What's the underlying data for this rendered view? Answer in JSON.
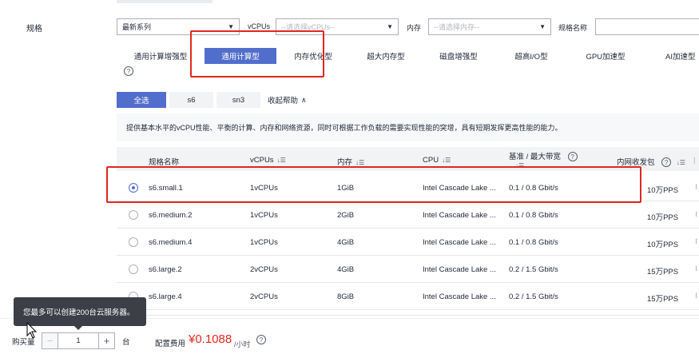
{
  "section_label": "规格",
  "filters": {
    "series": {
      "value": "最新系列"
    },
    "vcpu": {
      "label": "vCPUs",
      "placeholder": "--请选择vCPUs--"
    },
    "memory": {
      "label": "内存",
      "placeholder": "--请选择内存--"
    },
    "spec_name": {
      "label": "规格名称"
    }
  },
  "categories": [
    {
      "label": "通用计算增强型",
      "active": false
    },
    {
      "label": "通用计算型",
      "active": true
    },
    {
      "label": "内存优化型",
      "active": false
    },
    {
      "label": "超大内存型",
      "active": false
    },
    {
      "label": "磁盘增强型",
      "active": false
    },
    {
      "label": "超高I/O型",
      "active": false
    },
    {
      "label": "GPU加速型",
      "active": false
    },
    {
      "label": "AI加速型",
      "active": false
    }
  ],
  "subtabs": [
    {
      "label": "全选",
      "active": true
    },
    {
      "label": "s6",
      "active": false
    },
    {
      "label": "sn3",
      "active": false
    }
  ],
  "collapse_help": "收起帮助",
  "description": "提供基本水平的vCPU性能、平衡的计算、内存和网络资源，同时可根据工作负载的需要实现性能的突增，具有短期发挥更高性能的能力。",
  "table": {
    "headers": {
      "name": "规格名称",
      "vcpus": "vCPUs",
      "memory": "内存",
      "cpu": "CPU",
      "bandwidth_line1": "基准 / 最大带宽",
      "pps": "内网收发包"
    },
    "rows": [
      {
        "name": "s6.small.1",
        "vcpus": "1vCPUs",
        "memory": "1GiB",
        "cpu": "Intel Cascade Lake ...",
        "bandwidth": "0.1 / 0.8 Gbit/s",
        "pps": "10万PPS",
        "selected": true
      },
      {
        "name": "s6.medium.2",
        "vcpus": "1vCPUs",
        "memory": "2GiB",
        "cpu": "Intel Cascade Lake ...",
        "bandwidth": "0.1 / 0.8 Gbit/s",
        "pps": "10万PPS",
        "selected": false
      },
      {
        "name": "s6.medium.4",
        "vcpus": "1vCPUs",
        "memory": "4GiB",
        "cpu": "Intel Cascade Lake ...",
        "bandwidth": "0.1 / 0.8 Gbit/s",
        "pps": "10万PPS",
        "selected": false
      },
      {
        "name": "s6.large.2",
        "vcpus": "2vCPUs",
        "memory": "4GiB",
        "cpu": "Intel Cascade Lake ...",
        "bandwidth": "0.2 / 1.5 Gbit/s",
        "pps": "15万PPS",
        "selected": false
      },
      {
        "name": "s6.large.4",
        "vcpus": "2vCPUs",
        "memory": "8GiB",
        "cpu": "Intel Cascade Lake ...",
        "bandwidth": "0.2 / 1.5 Gbit/s",
        "pps": "15万PPS",
        "selected": false
      }
    ]
  },
  "tooltip": "您最多可以创建200台云服务器。",
  "footer": {
    "quantity_label": "购买量",
    "quantity_value": "1",
    "quantity_unit": "台",
    "fee_label": "配置费用",
    "price": "¥0.1088",
    "price_unit": "/小时"
  },
  "icons": {
    "help": "help-circle-icon",
    "sort": "sort-icon",
    "chevron": "chevron-up-icon",
    "caret": "caret-down-icon",
    "cursor": "mouse-pointer-icon"
  },
  "colors": {
    "primary": "#526ecc",
    "highlight": "#e0281e",
    "tooltip_bg": "#3c3f47"
  }
}
